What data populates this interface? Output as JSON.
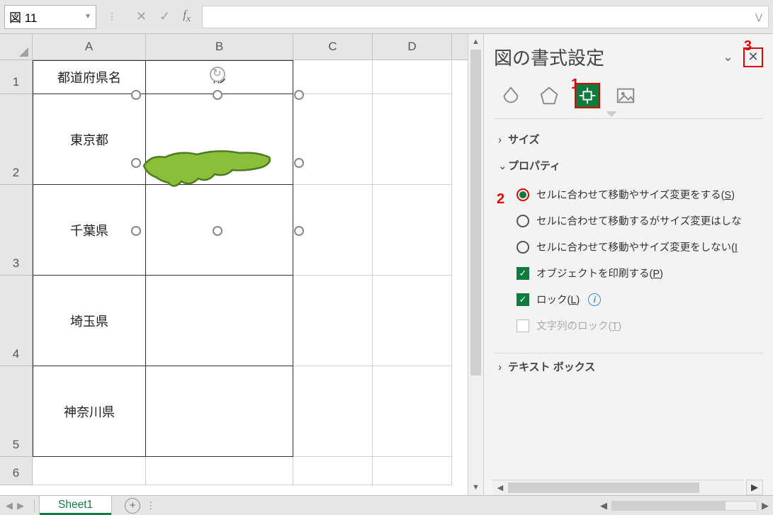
{
  "name_box": "図 11",
  "columns": [
    "A",
    "B",
    "C",
    "D"
  ],
  "row_numbers": [
    "1",
    "2",
    "3",
    "4",
    "5",
    "6"
  ],
  "table": {
    "A1": "都道府県名",
    "B1": "形",
    "A2": "東京都",
    "A3": "千葉県",
    "A4": "埼玉県",
    "A5": "神奈川県"
  },
  "panel": {
    "title": "図の書式設定",
    "sections": {
      "size": "サイズ",
      "properties": "プロパティ",
      "textbox": "テキスト ボックス"
    },
    "options": {
      "move_size": "セルに合わせて移動やサイズ変更をする(",
      "move_size_key": "S",
      "move_size_end": ")",
      "move_only": "セルに合わせて移動するがサイズ変更はしな",
      "no_move": "セルに合わせて移動やサイズ変更をしない(",
      "no_move_key": "I",
      "print": "オブジェクトを印刷する(",
      "print_key": "P",
      "print_end": ")",
      "lock": "ロック(",
      "lock_key": "L",
      "lock_end": ")",
      "textlock": "文字列のロック(",
      "textlock_key": "T",
      "textlock_end": ")"
    }
  },
  "callouts": {
    "c1": "1",
    "c2": "2",
    "c3": "3"
  },
  "sheet": {
    "name": "Sheet1"
  }
}
